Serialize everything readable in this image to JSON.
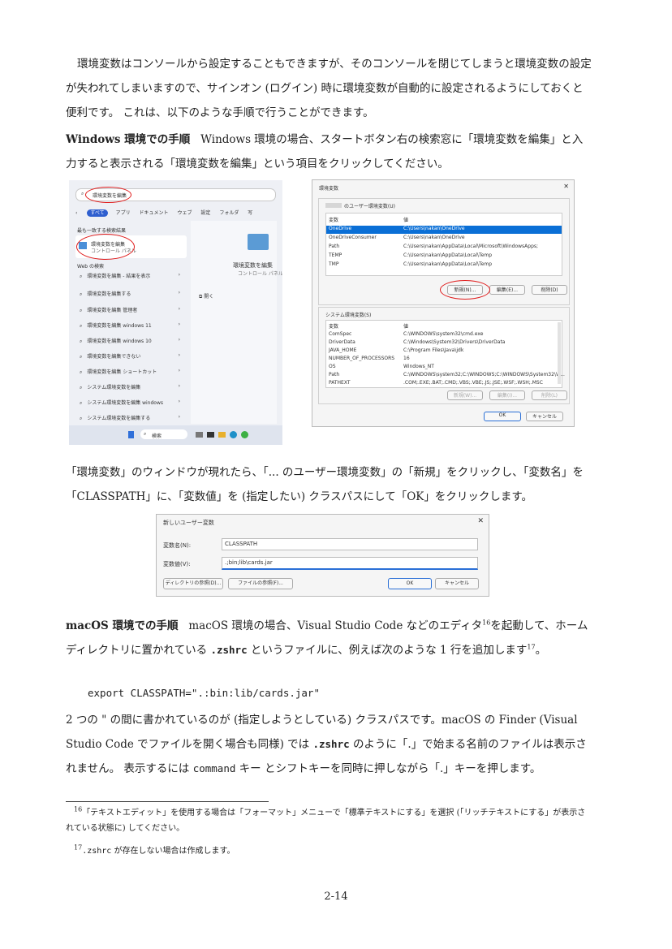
{
  "intro": "環境変数はコンソールから設定することもできますが、そのコンソールを閉じてしまうと環境変数の設定が失われてしまいますので、サインオン (ログイン) 時に環境変数が自動的に設定されるようにしておくと便利です。 これは、以下のような手順で行うことができます。",
  "win": {
    "heading": "Windows 環境での手順",
    "text": "Windows 環境の場合、スタートボタン右の検索窓に「環境変数を編集」と入力すると表示される「環境変数を編集」という項目をクリックしてください。"
  },
  "start_menu": {
    "search_text": "環境変数を編集",
    "tabs": [
      "すべて",
      "アプリ",
      "ドキュメント",
      "ウェブ",
      "設定",
      "フォルダ",
      "写"
    ],
    "best_match_header": "最も一致する検索結果",
    "best_match_title": "環境変数を編集",
    "best_match_sub": "コントロール パネル",
    "web_header": "Web の検索",
    "web_items": [
      "環境変数を編集 - 結果を表示",
      "環境変数を編集する",
      "環境変数を編集 管理者",
      "環境変数を編集 windows 11",
      "環境変数を編集 windows 10",
      "環境変数を編集できない",
      "環境変数を編集 ショートカット",
      "システム環境変数を編集",
      "システム環境変数を編集 windows",
      "システム環境変数を編集する"
    ],
    "preview_title": "環境変数を編集",
    "preview_sub": "コントロール パネル",
    "open_label": "開く",
    "taskbar_search": "検索"
  },
  "env_dialog": {
    "title": "環境変数",
    "user_section": "のユーザー環境変数(U)",
    "col_var": "変数",
    "col_val": "値",
    "user_vars": [
      [
        "OneDrive",
        "C:\\Users\\nakan\\OneDrive"
      ],
      [
        "OneDriveConsumer",
        "C:\\Users\\nakan\\OneDrive"
      ],
      [
        "Path",
        "C:\\Users\\nakan\\AppData\\Local\\Microsoft\\WindowsApps;"
      ],
      [
        "TEMP",
        "C:\\Users\\nakan\\AppData\\Local\\Temp"
      ],
      [
        "TMP",
        "C:\\Users\\nakan\\AppData\\Local\\Temp"
      ]
    ],
    "user_buttons": [
      "新規(N)...",
      "編集(E)...",
      "削除(D)"
    ],
    "sys_section": "システム環境変数(S)",
    "sys_vars": [
      [
        "ComSpec",
        "C:\\WINDOWS\\system32\\cmd.exe"
      ],
      [
        "DriverData",
        "C:\\Windows\\System32\\Drivers\\DriverData"
      ],
      [
        "JAVA_HOME",
        "C:\\Program Files\\Java\\jdk"
      ],
      [
        "NUMBER_OF_PROCESSORS",
        "16"
      ],
      [
        "OS",
        "Windows_NT"
      ],
      [
        "Path",
        "C:\\WINDOWS\\system32;C:\\WINDOWS;C:\\WINDOWS\\System32\\W..."
      ],
      [
        "PATHEXT",
        ".COM;.EXE;.BAT;.CMD;.VBS;.VBE;.JS;.JSE;.WSF;.WSH;.MSC"
      ]
    ],
    "sys_buttons": [
      "新規(W)...",
      "編集(I)...",
      "削除(L)"
    ],
    "ok": "OK",
    "cancel": "キャンセル"
  },
  "para2": "「環境変数」のウィンドウが現れたら、「... のユーザー環境変数」の「新規」をクリックし、「変数名」を「CLASSPATH」に、「変数値」を (指定したい) クラスパスにして「OK」をクリックします。",
  "new_var": {
    "title": "新しいユーザー変数",
    "name_label": "変数名(N):",
    "name_value": "CLASSPATH",
    "value_label": "変数値(V):",
    "value_value": ".;bin;lib\\cards.jar",
    "dir_button": "ディレクトリの参照(D)...",
    "file_button": "ファイルの参照(F)...",
    "ok": "OK",
    "cancel": "キャンセル"
  },
  "mac": {
    "heading": "macOS 環境での手順",
    "text_a": "macOS 環境の場合、Visual Studio Code などのエディタ",
    "fn_mark_a": "16",
    "text_b": "を起動して、ホームディレクトリに置かれている",
    "zshrc": ".zshrc",
    "text_c": "というファイルに、例えば次のような 1 行を追加します",
    "fn_mark_b": "17",
    "text_d": "。"
  },
  "code_line": "export CLASSPATH=\".:bin:lib/cards.jar\"",
  "para3": {
    "a": "2 つの \" の間に書かれているのが (指定しようとしている) クラスパスです。macOS の Finder (Visual Studio Code でファイルを開く場合も同様) では",
    "zshrc": ".zshrc",
    "b": "のように「.」で始まる名前のファイルは表示されません。 表示するには",
    "command": "command",
    "c": "キー とシフトキーを同時に押しながら「.」キーを押します。"
  },
  "footnotes": {
    "n16": "16",
    "f16": "「テキストエディット」を使用する場合は「フォーマット」メニューで「標準テキストにする」を選択 (「リッチテキストにする」が表示されている状態に) してください。",
    "n17": "17",
    "f17_code": ".zshrc",
    "f17": "が存在しない場合は作成します。"
  },
  "page_number": "2-14"
}
